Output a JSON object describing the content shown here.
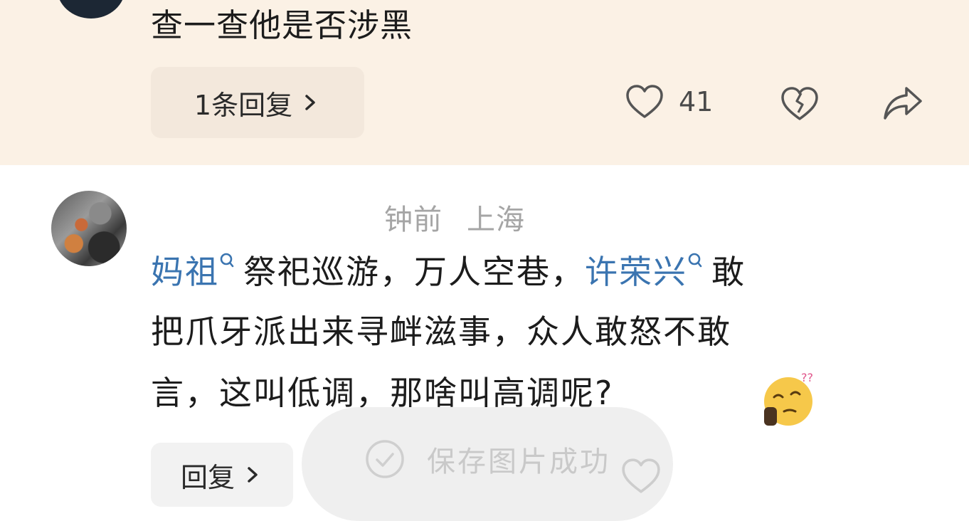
{
  "top_comment": {
    "text": "查一查他是否涉黑",
    "reply_chip_label": "1条回复",
    "like_count": "41"
  },
  "second_comment": {
    "meta_time": "钟前",
    "meta_location": "上海",
    "line1": {
      "mention1": "妈祖",
      "text1": "祭祀巡游，万人空巷，",
      "mention2": "许荣兴",
      "text2": "敢"
    },
    "line2": "把爪牙派出来寻衅滋事，众人敢怒不敢",
    "line3": "言，这叫低调，那啥叫高调呢?",
    "reply_chip_label": "回复"
  },
  "toast": {
    "text": "保存图片成功"
  },
  "colors": {
    "top_background": "#fbf1e5",
    "mention": "#3a74b0",
    "meta": "#a5a5a5"
  },
  "icons": [
    "heart-outline-icon",
    "broken-heart-icon",
    "share-arrow-icon",
    "search-mention-icon",
    "check-circle-icon",
    "thinking-emoji-icon",
    "chevron-right-icon"
  ]
}
